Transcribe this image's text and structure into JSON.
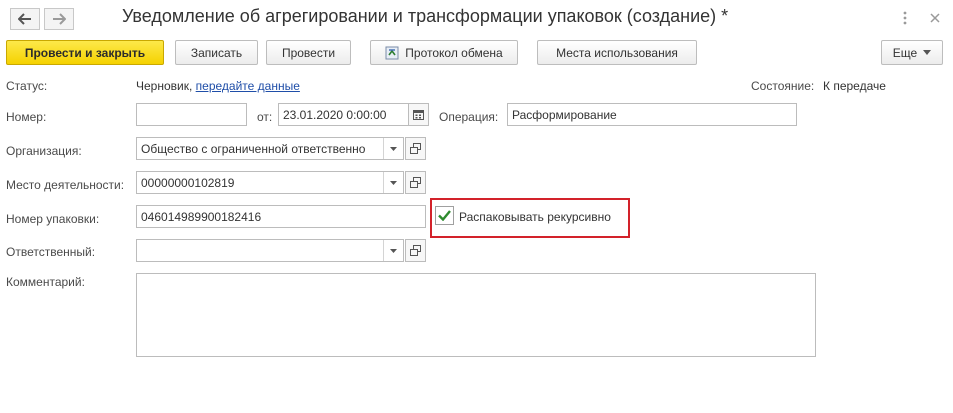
{
  "window": {
    "title": "Уведомление об агрегировании и трансформации упаковок (создание) *",
    "back_icon": "arrow-left-icon",
    "forward_icon": "arrow-right-icon",
    "menu_icon": "more-vertical-icon",
    "close_icon": "close-icon"
  },
  "toolbar": {
    "post_and_close": "Провести и закрыть",
    "save": "Записать",
    "post": "Провести",
    "exchange_log": "Протокол обмена",
    "usage_places": "Места использования",
    "more": "Еще"
  },
  "form": {
    "status_label": "Статус:",
    "status_value": "Черновик,",
    "status_link": "передайте данные",
    "state_label": "Состояние:",
    "state_value": "К передаче",
    "number_label": "Номер:",
    "number_value": "",
    "date_label": "от:",
    "date_value": "23.01.2020  0:00:00",
    "operation_label": "Операция:",
    "operation_value": "Расформирование",
    "organization_label": "Организация:",
    "organization_value": "Общество с ограниченной ответственно",
    "activity_place_label": "Место деятельности:",
    "activity_place_value": "00000000102819",
    "package_number_label": "Номер упаковки:",
    "package_number_value": "046014989900182416",
    "unpack_recursive_label": "Распаковывать рекурсивно",
    "unpack_recursive_checked": true,
    "responsible_label": "Ответственный:",
    "responsible_value": "",
    "comment_label": "Комментарий:",
    "comment_value": ""
  },
  "colors": {
    "primary_button": "#f5d200",
    "link": "#1f4ea8",
    "highlight_border": "#d3222a",
    "checkmark": "#2e8b2e"
  }
}
